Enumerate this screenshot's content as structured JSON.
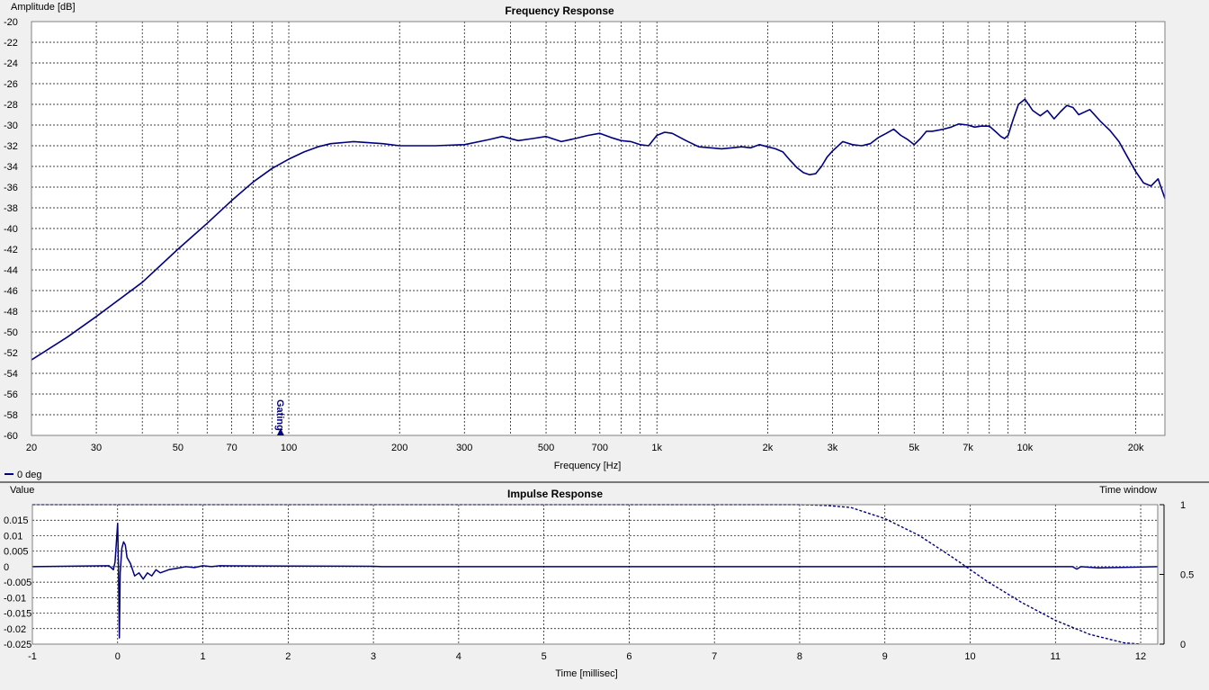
{
  "chart_data": [
    {
      "type": "line",
      "title": "Frequency Response",
      "xlabel": "Frequency [Hz]",
      "ylabel": "Amplitude [dB]",
      "xscale": "log",
      "xlim": [
        20,
        24000
      ],
      "ylim": [
        -60,
        -20
      ],
      "grid": true,
      "ytick_labels": [
        "-20",
        "-22",
        "-24",
        "-26",
        "-28",
        "-30",
        "-32",
        "-34",
        "-36",
        "-38",
        "-40",
        "-42",
        "-44",
        "-46",
        "-48",
        "-50",
        "-52",
        "-54",
        "-56",
        "-58",
        "-60"
      ],
      "xtick_labels": [
        {
          "v": 20,
          "t": "20"
        },
        {
          "v": 30,
          "t": "30"
        },
        {
          "v": 50,
          "t": "50"
        },
        {
          "v": 70,
          "t": "70"
        },
        {
          "v": 100,
          "t": "100"
        },
        {
          "v": 200,
          "t": "200"
        },
        {
          "v": 300,
          "t": "300"
        },
        {
          "v": 500,
          "t": "500"
        },
        {
          "v": 700,
          "t": "700"
        },
        {
          "v": 1000,
          "t": "1k"
        },
        {
          "v": 2000,
          "t": "2k"
        },
        {
          "v": 3000,
          "t": "3k"
        },
        {
          "v": 5000,
          "t": "5k"
        },
        {
          "v": 7000,
          "t": "7k"
        },
        {
          "v": 10000,
          "t": "10k"
        },
        {
          "v": 20000,
          "t": "20k"
        }
      ],
      "annotation": {
        "text": "Gating",
        "x": 95
      },
      "legend": {
        "placement": "bottom-left"
      },
      "series": [
        {
          "name": "0 deg",
          "color": "#000080",
          "x": [
            20,
            25,
            30,
            40,
            50,
            60,
            70,
            80,
            90,
            100,
            110,
            120,
            130,
            150,
            180,
            200,
            250,
            300,
            350,
            380,
            420,
            460,
            500,
            550,
            600,
            650,
            700,
            750,
            800,
            850,
            900,
            950,
            1000,
            1050,
            1100,
            1200,
            1300,
            1400,
            1500,
            1600,
            1700,
            1800,
            1900,
            2000,
            2100,
            2200,
            2300,
            2400,
            2500,
            2600,
            2700,
            2800,
            2900,
            3000,
            3200,
            3400,
            3600,
            3800,
            4000,
            4200,
            4400,
            4600,
            4800,
            5000,
            5200,
            5400,
            5600,
            5800,
            6000,
            6300,
            6600,
            7000,
            7300,
            7600,
            8000,
            8300,
            8600,
            8800,
            9000,
            9300,
            9600,
            10000,
            10500,
            11000,
            11500,
            12000,
            12500,
            13000,
            13500,
            14000,
            15000,
            16000,
            17000,
            18000,
            19000,
            20000,
            21000,
            22000,
            23000,
            24000
          ],
          "y": [
            -52.7,
            -50.5,
            -48.5,
            -45.2,
            -42.0,
            -39.5,
            -37.3,
            -35.5,
            -34.2,
            -33.3,
            -32.6,
            -32.1,
            -31.8,
            -31.6,
            -31.8,
            -32.0,
            -32.0,
            -31.9,
            -31.4,
            -31.1,
            -31.5,
            -31.3,
            -31.1,
            -31.6,
            -31.3,
            -31.0,
            -30.8,
            -31.2,
            -31.5,
            -31.6,
            -31.9,
            -32.0,
            -31.0,
            -30.7,
            -30.8,
            -31.5,
            -32.1,
            -32.2,
            -32.3,
            -32.2,
            -32.1,
            -32.2,
            -31.9,
            -32.1,
            -32.3,
            -32.6,
            -33.4,
            -34.1,
            -34.6,
            -34.8,
            -34.7,
            -34.0,
            -33.1,
            -32.5,
            -31.6,
            -31.9,
            -32.0,
            -31.8,
            -31.2,
            -30.8,
            -30.4,
            -31.0,
            -31.4,
            -31.9,
            -31.3,
            -30.6,
            -30.6,
            -30.5,
            -30.4,
            -30.2,
            -29.9,
            -30.0,
            -30.2,
            -30.1,
            -30.1,
            -30.6,
            -31.1,
            -31.3,
            -31.0,
            -29.4,
            -28.0,
            -27.5,
            -28.6,
            -29.1,
            -28.6,
            -29.4,
            -28.7,
            -28.1,
            -28.3,
            -29.0,
            -28.5,
            -29.6,
            -30.5,
            -31.6,
            -33.1,
            -34.5,
            -35.6,
            -35.9,
            -35.2,
            -37.1
          ]
        }
      ]
    },
    {
      "type": "line",
      "title": "Impulse Response",
      "xlabel": "Time [millisec]",
      "ylabel": "Value",
      "y2label": "Time window",
      "xlim": [
        -1,
        12.2
      ],
      "ylim": [
        -0.025,
        0.02
      ],
      "y2lim": [
        0,
        1
      ],
      "grid": true,
      "xtick_labels": [
        "-1",
        "0",
        "1",
        "2",
        "3",
        "4",
        "5",
        "6",
        "7",
        "8",
        "9",
        "10",
        "11",
        "12"
      ],
      "ytick_labels": [
        {
          "v": 0.015,
          "t": "0.015"
        },
        {
          "v": 0.01,
          "t": "0.01"
        },
        {
          "v": 0.005,
          "t": "0.005"
        },
        {
          "v": 0,
          "t": "0"
        },
        {
          "v": -0.005,
          "t": "-0.005"
        },
        {
          "v": -0.01,
          "t": "-0.01"
        },
        {
          "v": -0.015,
          "t": "-0.015"
        },
        {
          "v": -0.02,
          "t": "-0.02"
        },
        {
          "v": -0.025,
          "t": "-0.025"
        }
      ],
      "y2tick_labels": [
        {
          "v": 1,
          "t": "1"
        },
        {
          "v": 0.5,
          "t": "0.5"
        },
        {
          "v": 0,
          "t": "0"
        }
      ],
      "series": [
        {
          "name": "impulse",
          "color": "#000080",
          "x": [
            -1,
            -0.1,
            -0.05,
            -0.03,
            0,
            0.01,
            0.02,
            0.03,
            0.05,
            0.07,
            0.09,
            0.11,
            0.15,
            0.2,
            0.25,
            0.3,
            0.35,
            0.4,
            0.45,
            0.5,
            0.6,
            0.7,
            0.8,
            0.9,
            1.0,
            1.1,
            1.2,
            2,
            3,
            3.1,
            11.2,
            11.25,
            11.3,
            11.5,
            12.2
          ],
          "y": [
            0,
            0.0003,
            -0.001,
            0.0015,
            0.014,
            -0.001,
            -0.023,
            -0.002,
            0.006,
            0.008,
            0.007,
            0.003,
            0.001,
            -0.003,
            -0.002,
            -0.004,
            -0.002,
            -0.003,
            -0.001,
            -0.002,
            -0.001,
            -0.0005,
            0,
            -0.0003,
            0.0003,
            0,
            0.0003,
            0.0002,
            0.0001,
            0,
            0,
            -0.0008,
            0,
            -0.0004,
            0
          ]
        },
        {
          "name": "time window",
          "axis": "y2",
          "color": "#000080",
          "dashed": true,
          "x": [
            -1,
            8.0,
            8.3,
            8.6,
            9.0,
            9.4,
            9.8,
            10.2,
            10.6,
            11.0,
            11.4,
            11.8,
            12.0
          ],
          "y": [
            1,
            1,
            0.995,
            0.98,
            0.9,
            0.78,
            0.62,
            0.45,
            0.3,
            0.17,
            0.07,
            0.01,
            0
          ]
        }
      ]
    }
  ]
}
